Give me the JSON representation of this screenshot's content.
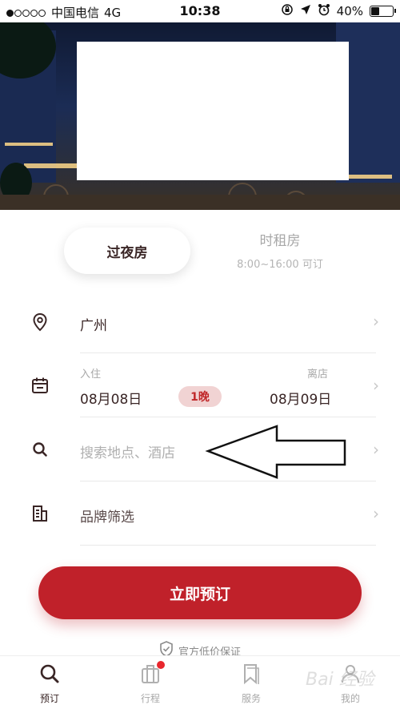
{
  "status_bar": {
    "carrier": "中国电信",
    "network": "4G",
    "time": "10:38",
    "battery_percent": "40%",
    "battery_level": 0.4
  },
  "stay_tabs": {
    "overnight": "过夜房",
    "hourly": "时租房",
    "hourly_note": "8:00~16:00 可订"
  },
  "form": {
    "city": "广州",
    "checkin_label": "入住",
    "checkout_label": "离店",
    "checkin_date": "08月08日",
    "checkout_date": "08月09日",
    "nights": "1晚",
    "search_placeholder": "搜索地点、酒店",
    "brand_filter": "品牌筛选"
  },
  "cta": {
    "label": "立即预订"
  },
  "guarantee": {
    "text": "官方低价保证"
  },
  "tabbar": {
    "items": [
      {
        "label": "预订",
        "icon": "search-icon"
      },
      {
        "label": "行程",
        "icon": "suitcase-icon"
      },
      {
        "label": "服务",
        "icon": "bookmark-icon"
      },
      {
        "label": "我的",
        "icon": "user-icon"
      }
    ]
  },
  "watermark": "Bai 经验",
  "colors": {
    "brand_red": "#c0212a",
    "nights_badge_bg": "#f1d3d3",
    "notification_dot": "#e8262d"
  }
}
